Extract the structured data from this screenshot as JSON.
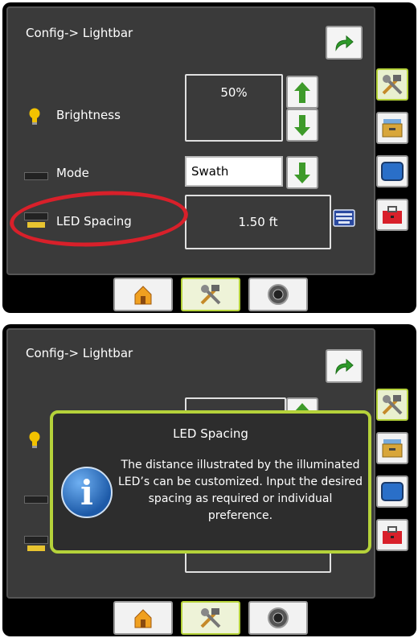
{
  "top": {
    "title": "Config-> Lightbar",
    "brightness_label": "Brightness",
    "brightness_value": "50%",
    "mode_label": "Mode",
    "mode_value": "Swath",
    "led_spacing_label": "LED Spacing",
    "led_spacing_value": "1.50 ft"
  },
  "bottom": {
    "title": "Config-> Lightbar",
    "popup_title": "LED Spacing",
    "popup_text": "The distance illustrated by the illuminated LED’s can be customized. Input the desired spacing as required or individual preference."
  },
  "colors": {
    "highlight": "#d8202a",
    "active_border": "#b5d23a",
    "arrow_green": "#3e9a2a",
    "bulb": "#f2c200"
  },
  "icons": {
    "back": "curved-arrow-right-icon",
    "up": "arrow-up-icon",
    "down": "arrow-down-icon",
    "keyboard": "keyboard-icon",
    "tools": "tools-icon",
    "drawer": "drawer-icon",
    "screen": "monitor-icon",
    "toolbox": "toolbox-icon",
    "home": "home-icon",
    "gauge": "gauge-icon",
    "info": "info-icon"
  }
}
